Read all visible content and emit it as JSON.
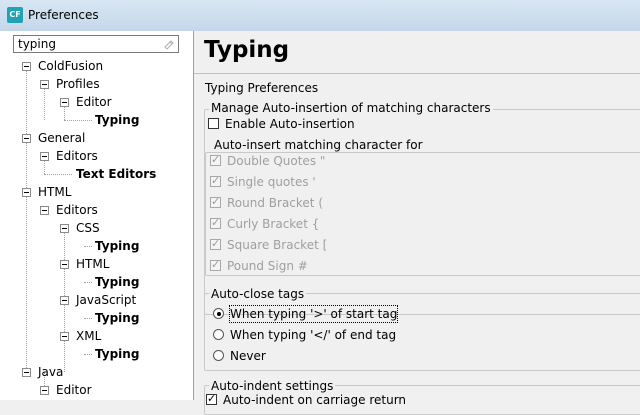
{
  "window": {
    "title": "Preferences",
    "icon_text": "CF"
  },
  "filter": {
    "value": "typing"
  },
  "tree": [
    {
      "label": "ColdFusion",
      "bold": false
    },
    {
      "label": "Profiles",
      "bold": false
    },
    {
      "label": "Editor",
      "bold": false
    },
    {
      "label": "Typing",
      "bold": true
    },
    {
      "label": "General",
      "bold": false
    },
    {
      "label": "Editors",
      "bold": false
    },
    {
      "label": "Text Editors",
      "bold": true
    },
    {
      "label": "HTML",
      "bold": false
    },
    {
      "label": "Editors",
      "bold": false
    },
    {
      "label": "CSS",
      "bold": false
    },
    {
      "label": "Typing",
      "bold": true
    },
    {
      "label": "HTML",
      "bold": false
    },
    {
      "label": "Typing",
      "bold": true
    },
    {
      "label": "JavaScript",
      "bold": false
    },
    {
      "label": "Typing",
      "bold": true
    },
    {
      "label": "XML",
      "bold": false
    },
    {
      "label": "Typing",
      "bold": true
    },
    {
      "label": "Java",
      "bold": false
    },
    {
      "label": "Editor",
      "bold": false
    }
  ],
  "page": {
    "title": "Typing",
    "subtitle": "Typing Preferences",
    "auto_insertion": {
      "label": "Manage Auto-insertion of matching characters",
      "enable_label": "Enable Auto-insertion",
      "enable_checked": false,
      "matching": {
        "label": "Auto-insert matching character for",
        "items": [
          "Double Quotes \"",
          "Single quotes '",
          "Round Bracket (",
          "Curly Bracket {",
          "Square Bracket [",
          "Pound Sign #"
        ]
      }
    },
    "auto_close": {
      "label": "Auto-close tags",
      "options": [
        "When typing '>' of start tag",
        "When typing '</' of end tag",
        "Never"
      ],
      "selected": 0
    },
    "auto_indent": {
      "label": "Auto-indent settings",
      "option": "Auto-indent on carriage return",
      "checked": true
    }
  }
}
